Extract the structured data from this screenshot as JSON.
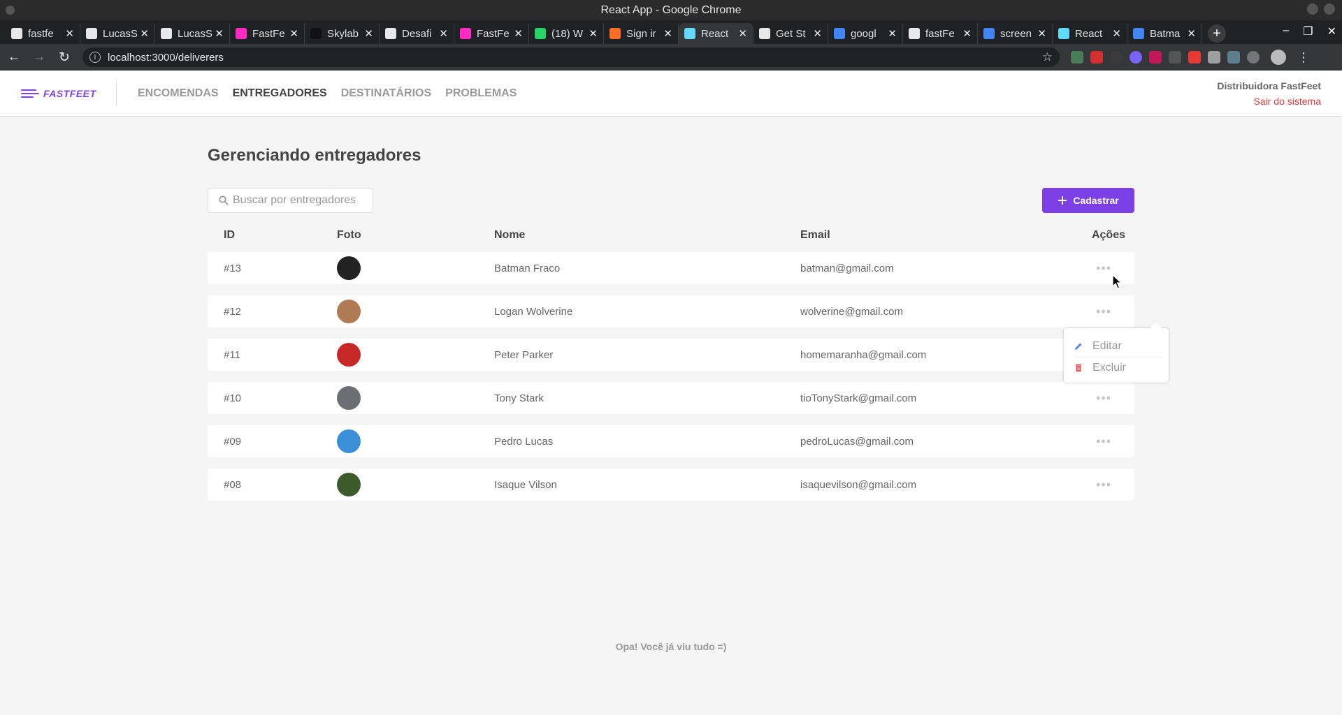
{
  "browser": {
    "window_title": "React App - Google Chrome",
    "url": "localhost:3000/deliverers",
    "tabs": [
      {
        "label": "fastfe",
        "icon": "github-icon",
        "color": "#e8e8e8"
      },
      {
        "label": "LucasS",
        "icon": "github-icon",
        "color": "#e8e8e8"
      },
      {
        "label": "LucasS",
        "icon": "github-icon",
        "color": "#e8e8e8"
      },
      {
        "label": "FastFe",
        "icon": "adobe-xd-icon",
        "color": "#ff2bc2"
      },
      {
        "label": "Skylab",
        "icon": "skylab-icon",
        "color": "#111111"
      },
      {
        "label": "Desafi",
        "icon": "rocketseat-icon",
        "color": "#e8e8e8"
      },
      {
        "label": "FastFe",
        "icon": "adobe-xd-icon",
        "color": "#ff2bc2"
      },
      {
        "label": "(18) W",
        "icon": "whatsapp-icon",
        "color": "#25d366"
      },
      {
        "label": "Sign ir",
        "icon": "gitlab-icon",
        "color": "#fc6d26"
      },
      {
        "label": "React",
        "icon": "react-icon",
        "color": "#61dafb"
      },
      {
        "label": "Get St",
        "icon": "triangle-icon",
        "color": "#e8e8e8"
      },
      {
        "label": "googl",
        "icon": "google-icon",
        "color": "#4285f4"
      },
      {
        "label": "fastFe",
        "icon": "github-icon",
        "color": "#e8e8e8"
      },
      {
        "label": "screen",
        "icon": "google-icon",
        "color": "#4285f4"
      },
      {
        "label": "React",
        "icon": "react-icon",
        "color": "#61dafb"
      },
      {
        "label": "Batma",
        "icon": "google-icon",
        "color": "#4285f4"
      }
    ],
    "active_tab_index": 9,
    "new_tab_symbol": "+"
  },
  "app": {
    "brand": "FASTFEET",
    "brand_color": "#7d40e7",
    "nav": [
      {
        "label": "ENCOMENDAS",
        "active": false
      },
      {
        "label": "ENTREGADORES",
        "active": true
      },
      {
        "label": "DESTINATÁRIOS",
        "active": false
      },
      {
        "label": "PROBLEMAS",
        "active": false
      }
    ],
    "account_name": "Distribuidora FastFeet",
    "logout_label": "Sair do sistema",
    "logout_color": "#de3b3b"
  },
  "page": {
    "title": "Gerenciando entregadores",
    "search_placeholder": "Buscar por entregadores",
    "add_button_label": "Cadastrar",
    "columns": {
      "id": "ID",
      "foto": "Foto",
      "nome": "Nome",
      "email": "Email",
      "acoes": "Ações"
    },
    "rows": [
      {
        "id": "#13",
        "name": "Batman Fraco",
        "email": "batman@gmail.com",
        "avatar": "batman-avatar",
        "avatar_color": "#222222"
      },
      {
        "id": "#12",
        "name": "Logan Wolverine",
        "email": "wolverine@gmail.com",
        "avatar": "wolverine-avatar",
        "avatar_color": "#b07a55"
      },
      {
        "id": "#11",
        "name": "Peter Parker",
        "email": "homemaranha@gmail.com",
        "avatar": "spiderman-avatar",
        "avatar_color": "#c62828"
      },
      {
        "id": "#10",
        "name": "Tony Stark",
        "email": "tioTonyStark@gmail.com",
        "avatar": "tony-avatar",
        "avatar_color": "#6b6f73"
      },
      {
        "id": "#09",
        "name": "Pedro Lucas",
        "email": "pedroLucas@gmail.com",
        "avatar": "pedro-avatar",
        "avatar_color": "#3b8fd6"
      },
      {
        "id": "#08",
        "name": "Isaque Vilson",
        "email": "isaquevilson@gmail.com",
        "avatar": "isaque-avatar",
        "avatar_color": "#3c5a2a"
      }
    ],
    "actions_menu": {
      "open_for_row": "#13",
      "items": [
        {
          "label": "Editar",
          "icon": "pencil-icon",
          "color": "#4d85ee"
        },
        {
          "label": "Excluir",
          "icon": "trash-icon",
          "color": "#de3b3b"
        }
      ]
    },
    "footer_message": "Opa! Você já viu tudo =)"
  }
}
